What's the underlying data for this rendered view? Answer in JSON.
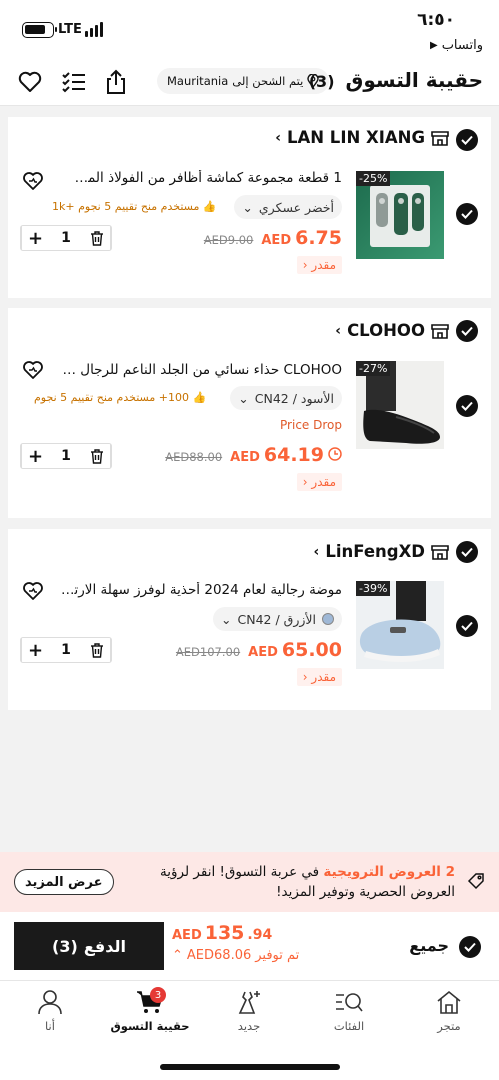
{
  "status": {
    "time": "٦:٥٠",
    "network": "LTE",
    "back_app": "واتساب"
  },
  "header": {
    "title": "حقيبة التسوق",
    "count": "(3)",
    "ship_prefix": "يتم الشحن إلى",
    "ship_country": "Mauritania"
  },
  "stores": [
    {
      "name": "LAN LIN XIANG",
      "item": {
        "title": "1 قطعة مجموعة كماشة أظافر من الفولاذ المقاوم...",
        "variant": "أخضر عسكري",
        "rating": "مستخدم منح تقييم 5 نجوم +1k",
        "price_currency": "AED",
        "price": "6.75",
        "old_price": "AED9.00",
        "discount": "-25%",
        "estimate": "مقدر",
        "qty": "1"
      }
    },
    {
      "name": "CLOHOO",
      "item": {
        "title": "CLOHOO حذاء نسائي من الجلد الناعم للرجال م...",
        "variant": "الأسود / CN42",
        "rating": "100+ مستخدم منح تقييم 5 نجوم",
        "price_drop": "Price Drop",
        "price_currency": "AED",
        "price": "64.19",
        "old_price": "AED88.00",
        "discount": "-27%",
        "estimate": "مقدر",
        "qty": "1"
      }
    },
    {
      "name": "LinFengXD",
      "item": {
        "title": "موضة رجالية لعام 2024 أحذية لوفرز سهلة الارتد...",
        "variant": "الأزرق / CN42",
        "price_currency": "AED",
        "price": "65.00",
        "old_price": "AED107.00",
        "discount": "-39%",
        "estimate": "مقدر",
        "qty": "1"
      }
    }
  ],
  "promo": {
    "highlight": "2 العروض الترويجية",
    "text": "في عربة التسوق! انقر لرؤية العروض الحصرية وتوفير المزيد!",
    "button": "عرض المزيد"
  },
  "checkout": {
    "all_label": "جميع",
    "total_currency": "AED",
    "total_int": "135",
    "total_dec": ".94",
    "saving_label": "تم توفير",
    "saving_value": "AED68.06",
    "pay_label": "الدفع",
    "pay_count": "(3)"
  },
  "tabs": [
    {
      "label": "متجر"
    },
    {
      "label": "الفئات"
    },
    {
      "label": "جديد"
    },
    {
      "label": "حقيبة التسوق",
      "badge": "3"
    },
    {
      "label": "أنا"
    }
  ],
  "colors": {
    "accent": "#fa6338",
    "primary": "#111111",
    "promo_bg": "#fde8e6"
  }
}
